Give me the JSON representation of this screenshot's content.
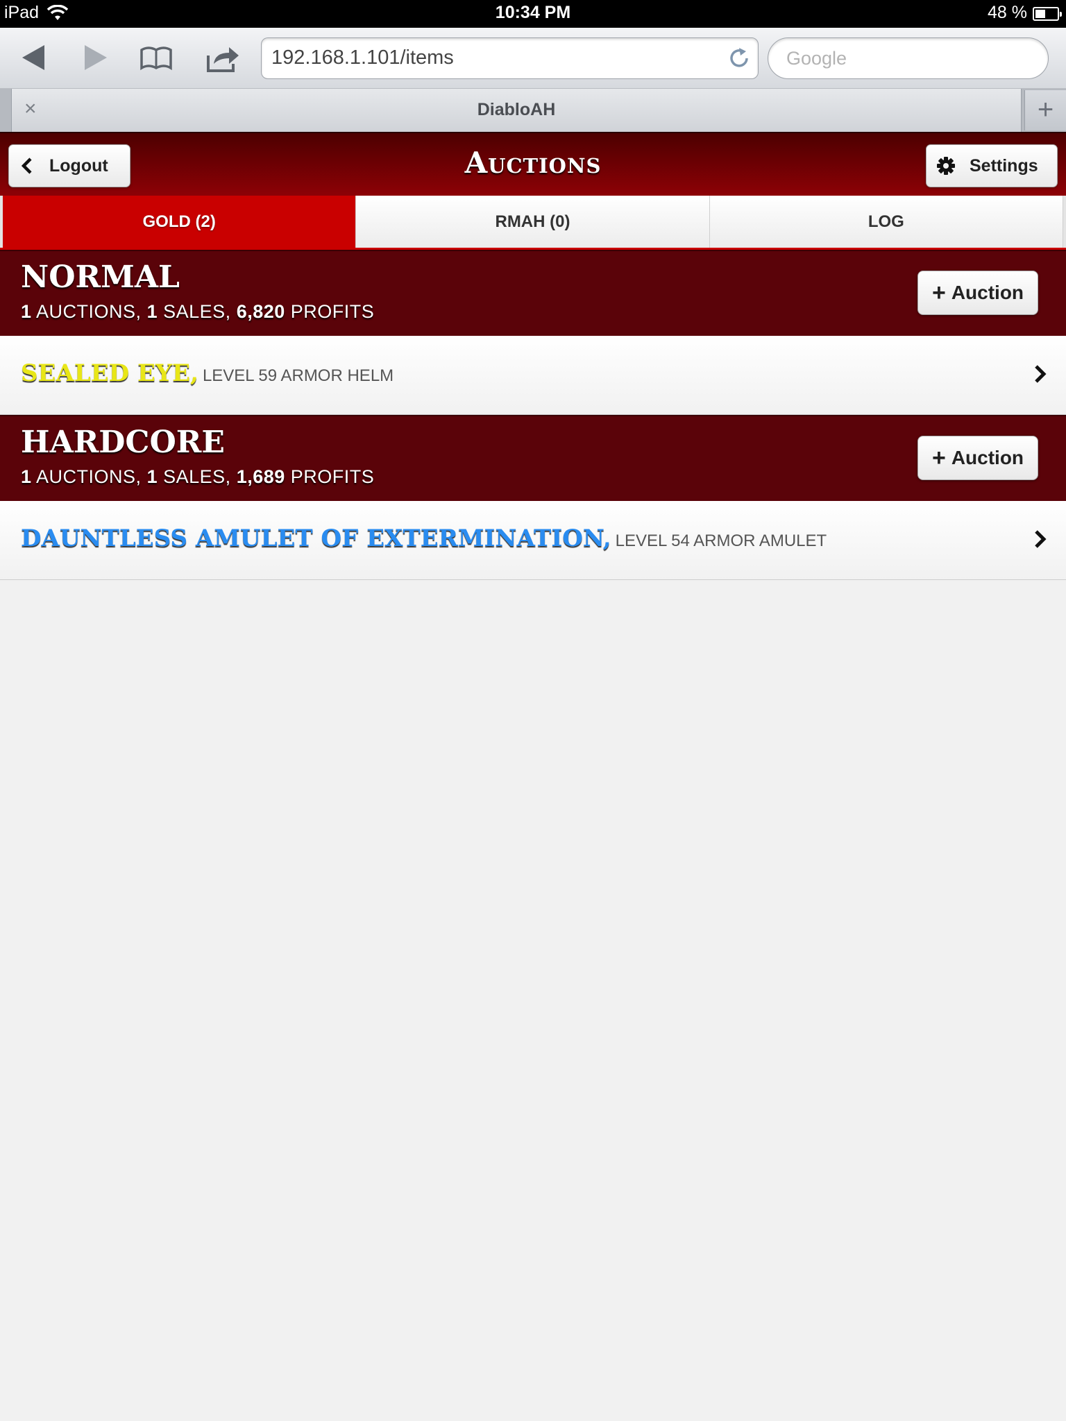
{
  "status_bar": {
    "device": "iPad",
    "time": "10:34 PM",
    "battery": "48 %",
    "battery_level": 0.48
  },
  "browser": {
    "url": "192.168.1.101/items",
    "search_placeholder": "Google",
    "tab_title": "DiabloAH",
    "tab_close": "×",
    "new_tab": "+"
  },
  "header": {
    "title": "Auctions",
    "logout_label": "Logout",
    "settings_label": "Settings"
  },
  "tabs": [
    {
      "label": "GOLD (2)",
      "active": true
    },
    {
      "label": "RMAH (0)",
      "active": false
    },
    {
      "label": "LOG",
      "active": false
    }
  ],
  "sections": [
    {
      "name": "NORMAL",
      "auctions": "1",
      "auctions_label": "AUCTIONS,",
      "sales": "1",
      "sales_label": "SALES,",
      "profits": "6,820",
      "profits_label": "PROFITS",
      "add_label": "Auction",
      "item": {
        "name": "SEALED EYE,",
        "desc": "LEVEL 59 ARMOR HELM",
        "color": "#e8e617"
      }
    },
    {
      "name": "HARDCORE",
      "auctions": "1",
      "auctions_label": "AUCTIONS,",
      "sales": "1",
      "sales_label": "SALES,",
      "profits": "1,689",
      "profits_label": "PROFITS",
      "add_label": "Auction",
      "item": {
        "name": "DAUNTLESS AMULET OF EXTERMINATION,",
        "desc": "LEVEL 54 ARMOR AMULET",
        "color": "#2a8cf0"
      }
    }
  ]
}
